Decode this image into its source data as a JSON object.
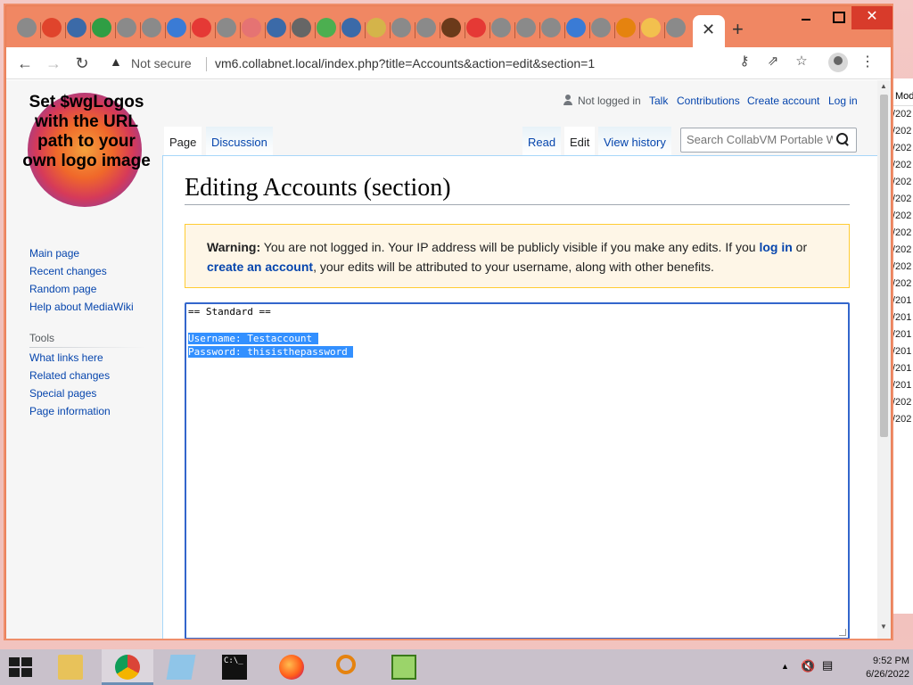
{
  "browser": {
    "active_tab_close": "✕",
    "new_tab": "+",
    "address": {
      "security": "Not secure",
      "url": "vm6.collabnet.local/index.php?title=Accounts&action=edit&section=1"
    }
  },
  "wiki": {
    "logo_text": "Set $wgLogos with the URL path to your own logo image",
    "personal": {
      "status": "Not logged in",
      "talk": "Talk",
      "contributions": "Contributions",
      "create_account": "Create account",
      "log_in": "Log in"
    },
    "tabs": {
      "page": "Page",
      "discussion": "Discussion",
      "read": "Read",
      "edit": "Edit",
      "view_history": "View history"
    },
    "search_placeholder": "Search CollabVM Portable W",
    "navigation": [
      "Main page",
      "Recent changes",
      "Random page",
      "Help about MediaWiki"
    ],
    "tools_heading": "Tools",
    "tools": [
      "What links here",
      "Related changes",
      "Special pages",
      "Page information"
    ],
    "title": "Editing Accounts (section)",
    "warning": {
      "label": "Warning:",
      "text1": " You are not logged in. Your IP address will be publicly visible if you make any edits. If you ",
      "link1": "log in",
      "text2": " or",
      "link2": "create an account",
      "text3": ", your edits will be attributed to your username, along with other benefits."
    },
    "editor_lines": [
      {
        "text": "== Standard ==",
        "selected": false
      },
      {
        "text": "",
        "selected": false
      },
      {
        "text": "Username: Testaccount ",
        "selected": true
      },
      {
        "text": "Password: thisisthepassword ",
        "selected": true
      }
    ]
  },
  "background_window": {
    "header": "Mod",
    "rows": [
      "/202",
      "/202",
      "/202",
      "/202",
      "/202",
      "/202",
      "/202",
      "/202",
      "/202",
      "/202",
      "/202",
      "/201",
      "/201",
      "/201",
      "/201",
      "/201",
      "/201",
      "/202",
      "/202"
    ]
  },
  "taskbar": {
    "time": "9:52 PM",
    "date": "6/26/2022"
  },
  "colors": {
    "tabstrip": "#f08763",
    "link": "#0645ad",
    "selection": "#3390ff"
  }
}
